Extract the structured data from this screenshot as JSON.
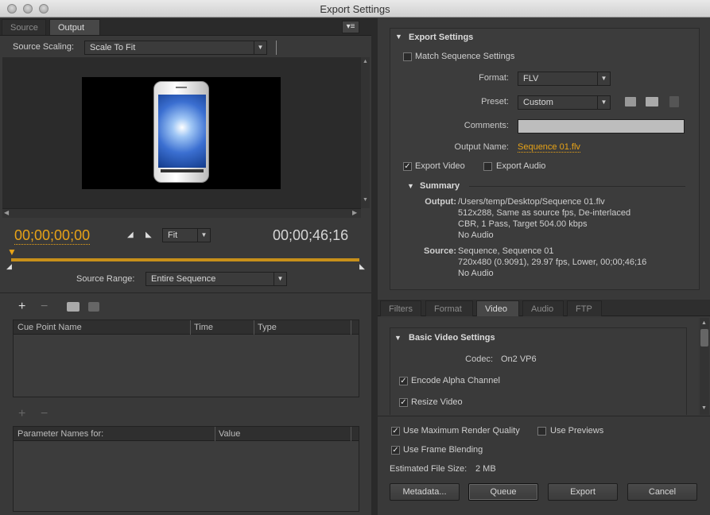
{
  "window": {
    "title": "Export Settings"
  },
  "left": {
    "tabs": [
      "Source",
      "Output"
    ],
    "active_tab": "Output",
    "source_scaling_label": "Source Scaling:",
    "source_scaling_value": "Scale To Fit",
    "timecode_current": "00;00;00;00",
    "zoom_value": "Fit",
    "timecode_duration": "00;00;46;16",
    "source_range_label": "Source Range:",
    "source_range_value": "Entire Sequence",
    "cue_grid": {
      "columns": [
        "Cue Point Name",
        "Time",
        "Type"
      ]
    },
    "param_grid": {
      "columns": [
        "Parameter Names for:",
        "Value"
      ]
    }
  },
  "export_settings": {
    "header": "Export Settings",
    "match_sequence": "Match Sequence Settings",
    "format_label": "Format:",
    "format_value": "FLV",
    "preset_label": "Preset:",
    "preset_value": "Custom",
    "comments_label": "Comments:",
    "comments_value": "",
    "output_name_label": "Output Name:",
    "output_name_value": "Sequence 01.flv",
    "export_video": "Export Video",
    "export_audio": "Export Audio"
  },
  "summary": {
    "header": "Summary",
    "output_label": "Output:",
    "output_lines": [
      "/Users/temp/Desktop/Sequence 01.flv",
      "512x288, Same as source fps, De-interlaced",
      "CBR, 1 Pass, Target 504.00 kbps",
      "No Audio"
    ],
    "source_label": "Source:",
    "source_lines": [
      "Sequence, Sequence 01",
      "720x480 (0.9091), 29.97 fps, Lower, 00;00;46;16",
      "No Audio"
    ]
  },
  "bottom_tabs": [
    "Filters",
    "Format",
    "Video",
    "Audio",
    "FTP"
  ],
  "active_bottom_tab": "Video",
  "video": {
    "header": "Basic Video Settings",
    "codec_label": "Codec:",
    "codec_value": "On2 VP6",
    "encode_alpha": "Encode Alpha Channel",
    "resize_video": "Resize Video"
  },
  "options": {
    "max_render_quality": "Use Maximum Render Quality",
    "use_previews": "Use Previews",
    "frame_blending": "Use Frame Blending",
    "file_size_label": "Estimated File Size:",
    "file_size_value": "2 MB"
  },
  "buttons": {
    "metadata": "Metadata...",
    "queue": "Queue",
    "export": "Export",
    "cancel": "Cancel"
  },
  "colors": {
    "accent": "#e8a317",
    "timeline": "#c8901a",
    "link": "#e8a317"
  },
  "icons": [
    "panel-menu-icon",
    "add-icon",
    "remove-icon",
    "save-preset-icon",
    "import-preset-icon",
    "delete-preset-icon",
    "mark-in-icon",
    "mark-out-icon",
    "playhead-icon"
  ]
}
